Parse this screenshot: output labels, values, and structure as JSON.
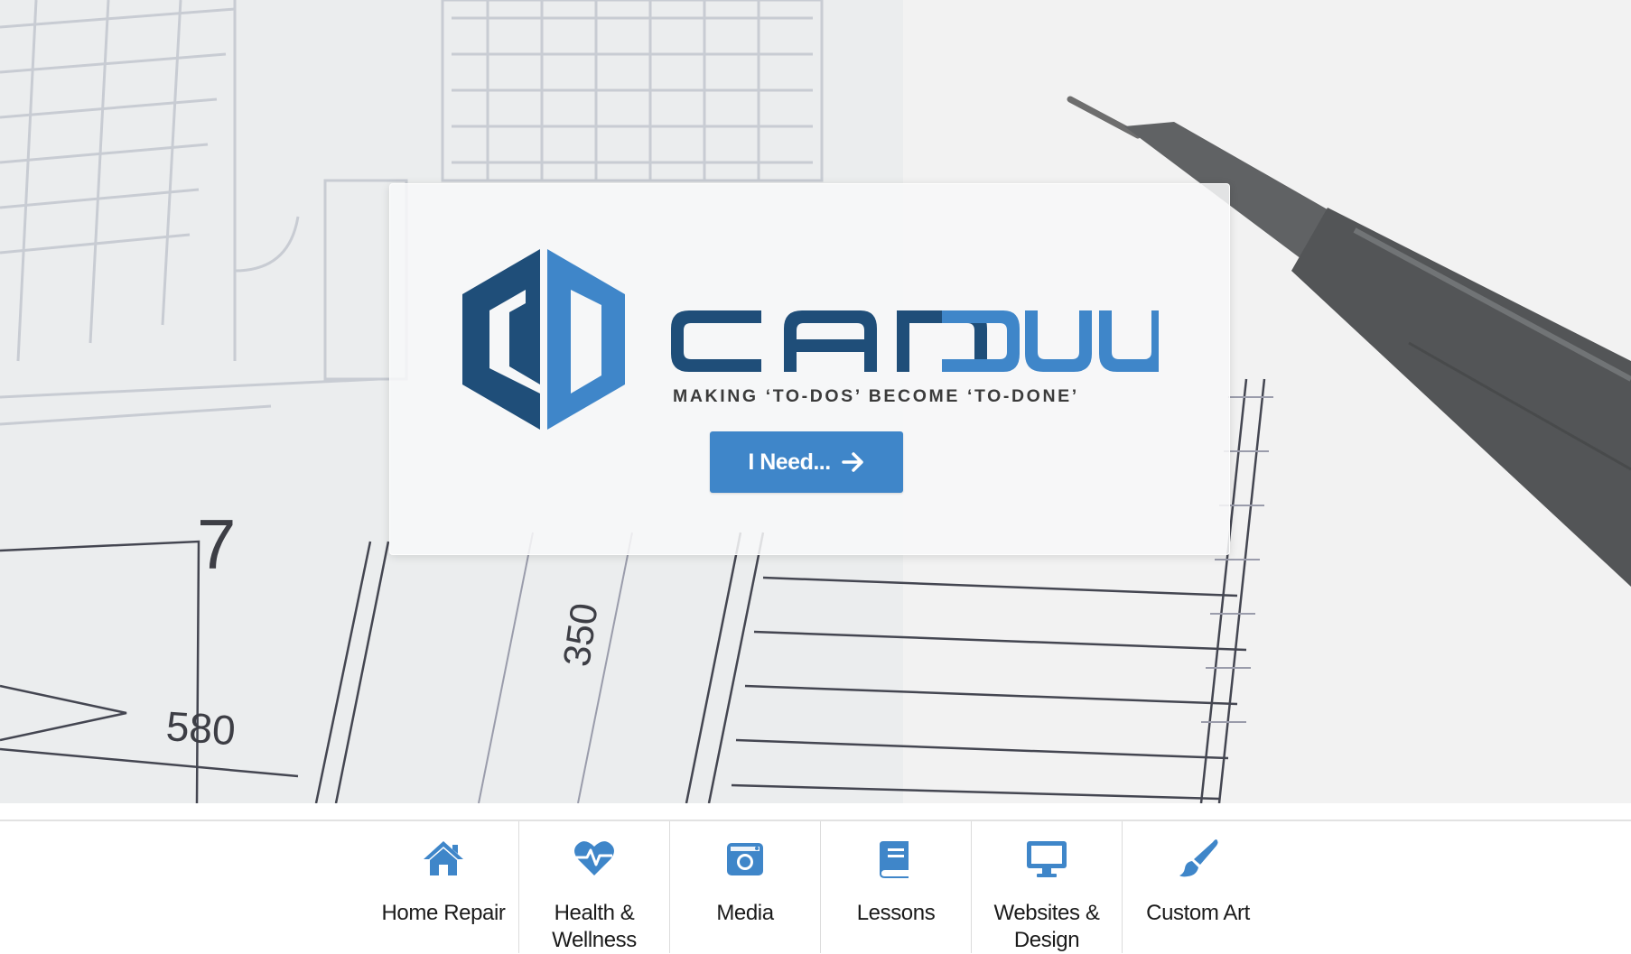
{
  "hero": {
    "tagline": "MAKING ‘TO-DOS’ BECOME ‘TO-DONE’",
    "brand_wordmark": "CAN DUU",
    "cta_label": "I Need...",
    "cta_icon": "arrow-right-icon"
  },
  "colors": {
    "brand_dark": "#1f4e79",
    "brand_light": "#3f86c9",
    "button": "#3f86c9",
    "icon": "#3f86c9"
  },
  "categories": [
    {
      "label": "Home Repair",
      "icon": "home-icon"
    },
    {
      "label": "Health & Wellness",
      "icon": "heartbeat-icon"
    },
    {
      "label": "Media",
      "icon": "camera-icon"
    },
    {
      "label": "Lessons",
      "icon": "book-icon"
    },
    {
      "label": "Websites & Design",
      "icon": "desktop-icon"
    },
    {
      "label": "Custom Art",
      "icon": "paintbrush-icon"
    }
  ]
}
